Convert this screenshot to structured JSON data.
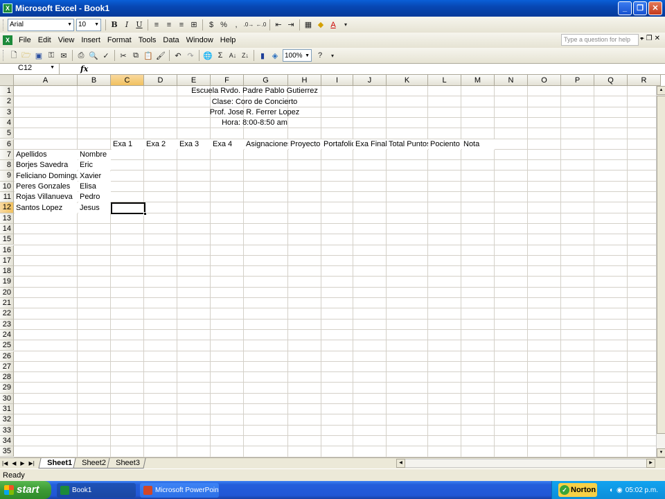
{
  "window": {
    "title": "Microsoft Excel - Book1"
  },
  "format_toolbar": {
    "font": "Arial",
    "size": "10"
  },
  "menu": [
    "File",
    "Edit",
    "View",
    "Insert",
    "Format",
    "Tools",
    "Data",
    "Window",
    "Help"
  ],
  "help_box": {
    "placeholder": "Type a question for help"
  },
  "std_toolbar": {
    "zoom": "100%"
  },
  "formula_bar": {
    "name_box": "C12",
    "fx": "fx"
  },
  "columns": [
    "A",
    "B",
    "C",
    "D",
    "E",
    "F",
    "G",
    "H",
    "I",
    "J",
    "K",
    "L",
    "M",
    "N",
    "O",
    "P",
    "Q",
    "R"
  ],
  "rows": [
    "1",
    "2",
    "3",
    "4",
    "5",
    "6",
    "7",
    "8",
    "9",
    "10",
    "11",
    "12",
    "13",
    "14",
    "15",
    "16",
    "17",
    "18",
    "19",
    "20",
    "21",
    "22",
    "23",
    "24",
    "25",
    "26",
    "27",
    "28",
    "29",
    "30",
    "31",
    "32",
    "33",
    "34",
    "35"
  ],
  "active_cell": "C12",
  "sheet": {
    "header_lines": [
      "Escuela Rvdo. Padre Pablo Gutierrez",
      "Clase: Coro de Concierto",
      "Prof. Jose R. Ferrer Lopez",
      "Hora: 8:00-8:50 am"
    ],
    "row6": [
      "Exa 1",
      "Exa 2",
      "Exa 3",
      "Exa 4",
      "Asignaciones",
      "Proyecto",
      "Portafolio",
      "Exa Final",
      "Total Puntos",
      "Pociento",
      "Nota"
    ],
    "row7": [
      "Apellidos",
      "Nombre"
    ],
    "students": [
      {
        "apellidos": "Borjes Savedra",
        "nombre": "Eric"
      },
      {
        "apellidos": "Feliciano Dominguez",
        "nombre": "Xavier"
      },
      {
        "apellidos": "Peres Gonzales",
        "nombre": "Elisa"
      },
      {
        "apellidos": "Rojas Villanueva",
        "nombre": "Pedro"
      },
      {
        "apellidos": "Santos Lopez",
        "nombre": "Jesus"
      }
    ]
  },
  "tabs": [
    "Sheet1",
    "Sheet2",
    "Sheet3"
  ],
  "status": "Ready",
  "taskbar": {
    "start": "start",
    "items": [
      "Book1",
      "Microsoft PowerPoint ..."
    ],
    "norton": "Norton",
    "clock": "05:02 p.m."
  }
}
